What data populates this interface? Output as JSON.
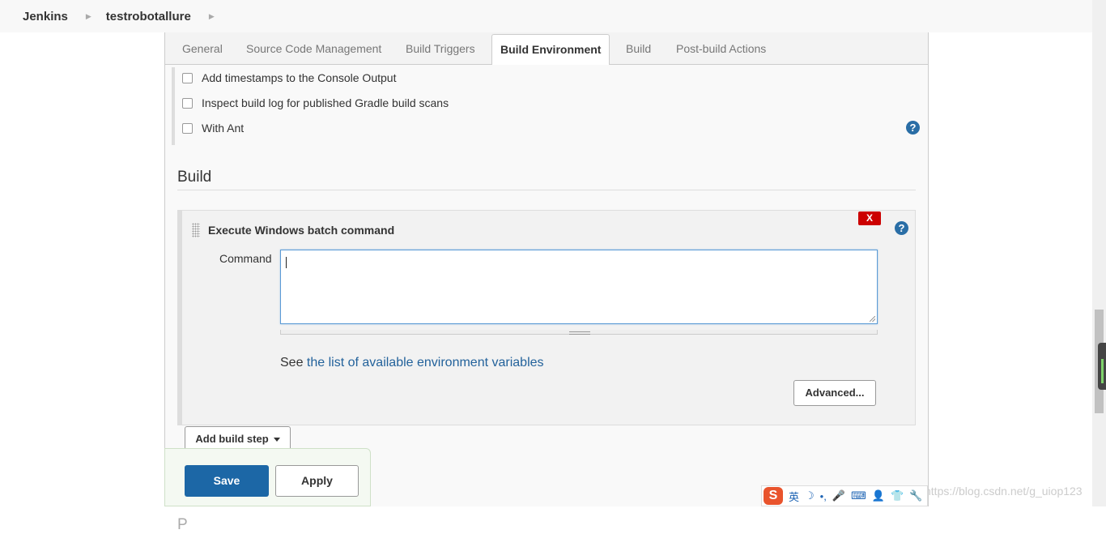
{
  "breadcrumb": {
    "home": "Jenkins",
    "job": "testrobotallure"
  },
  "tabs": [
    {
      "label": "General"
    },
    {
      "label": "Source Code Management"
    },
    {
      "label": "Build Triggers"
    },
    {
      "label": "Build Environment",
      "active": true
    },
    {
      "label": "Build"
    },
    {
      "label": "Post-build Actions"
    }
  ],
  "build_environment": {
    "options": [
      {
        "label": "Add timestamps to the Console Output",
        "checked": false
      },
      {
        "label": "Inspect build log for published Gradle build scans",
        "checked": false
      },
      {
        "label": "With Ant",
        "checked": false
      }
    ],
    "help_icon": "?"
  },
  "build": {
    "section_title": "Build",
    "step": {
      "title": "Execute Windows batch command",
      "delete_label": "X",
      "help_icon": "?",
      "command_label": "Command",
      "command_value": "",
      "env_prefix": "See ",
      "env_link": "the list of available environment variables",
      "advanced_label": "Advanced..."
    },
    "add_step_label": "Add build step"
  },
  "partial_section_text": "P",
  "actions": {
    "save_label": "Save",
    "apply_label": "Apply"
  },
  "ime": {
    "logo": "S",
    "lang": "英",
    "items": [
      "☽",
      "•,",
      "🎤",
      "⌨",
      "👤",
      "👕",
      "🔧"
    ]
  },
  "watermark": "https://blog.csdn.net/g_uiop123",
  "colors": {
    "accent": "#1c67a6",
    "link": "#23629b",
    "delete": "#cc0000"
  }
}
